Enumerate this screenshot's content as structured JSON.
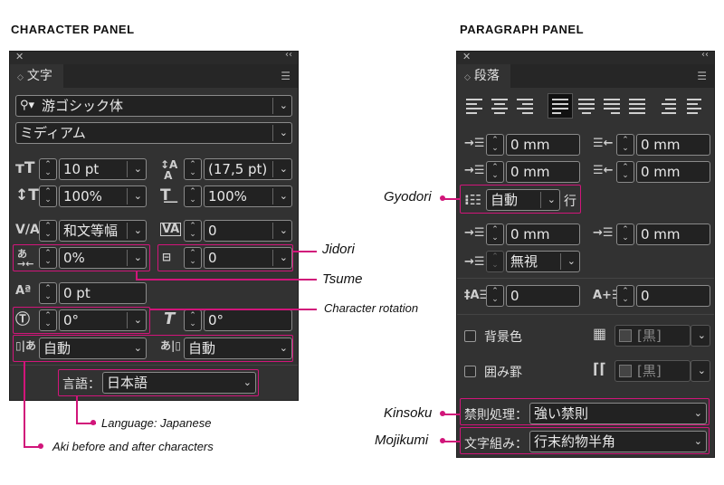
{
  "headings": {
    "character": "CHARACTER PANEL",
    "paragraph": "PARAGRAPH PANEL"
  },
  "character_panel": {
    "tab": "文字",
    "font_family": "游ゴシック体",
    "font_style": "ミディアム",
    "font_size": "10 pt",
    "leading": "(17,5 pt)",
    "vertical_scale": "100%",
    "horizontal_scale": "100%",
    "kerning": "和文等幅",
    "tracking": "0",
    "tsume": "0%",
    "jidori": "0",
    "baseline_shift": "0 pt",
    "character_rotation": "0°",
    "skew": "0°",
    "aki_before": "自動",
    "aki_after": "自動",
    "language_label": "言語：",
    "language": "日本語"
  },
  "paragraph_panel": {
    "tab": "段落",
    "left_indent": "0 mm",
    "right_indent": "0 mm",
    "first_line_indent": "0 mm",
    "last_line_indent": "0 mm",
    "gyodori": "自動",
    "gyodori_unit": "行",
    "space_before": "0 mm",
    "space_after": "0 mm",
    "grid_align": "無視",
    "drop_cap_lines": "0",
    "drop_cap_chars": "0",
    "shading_label": "背景色",
    "shading_color": "[黒]",
    "border_label": "囲み罫",
    "border_color": "[黒]",
    "kinsoku_label": "禁則処理：",
    "kinsoku": "強い禁則",
    "mojikumi_label": "文字組み：",
    "mojikumi": "行末約物半角"
  },
  "annotations": {
    "jidori": "Jidori",
    "tsume": "Tsume",
    "character_rotation": "Character rotation",
    "language": "Language: Japanese",
    "aki": "Aki before and after characters",
    "gyodori": "Gyodori",
    "kinsoku": "Kinsoku",
    "mojikumi": "Mojikumi"
  },
  "colors": {
    "accent": "#d1157a",
    "panel": "#323232",
    "field": "#222222"
  }
}
